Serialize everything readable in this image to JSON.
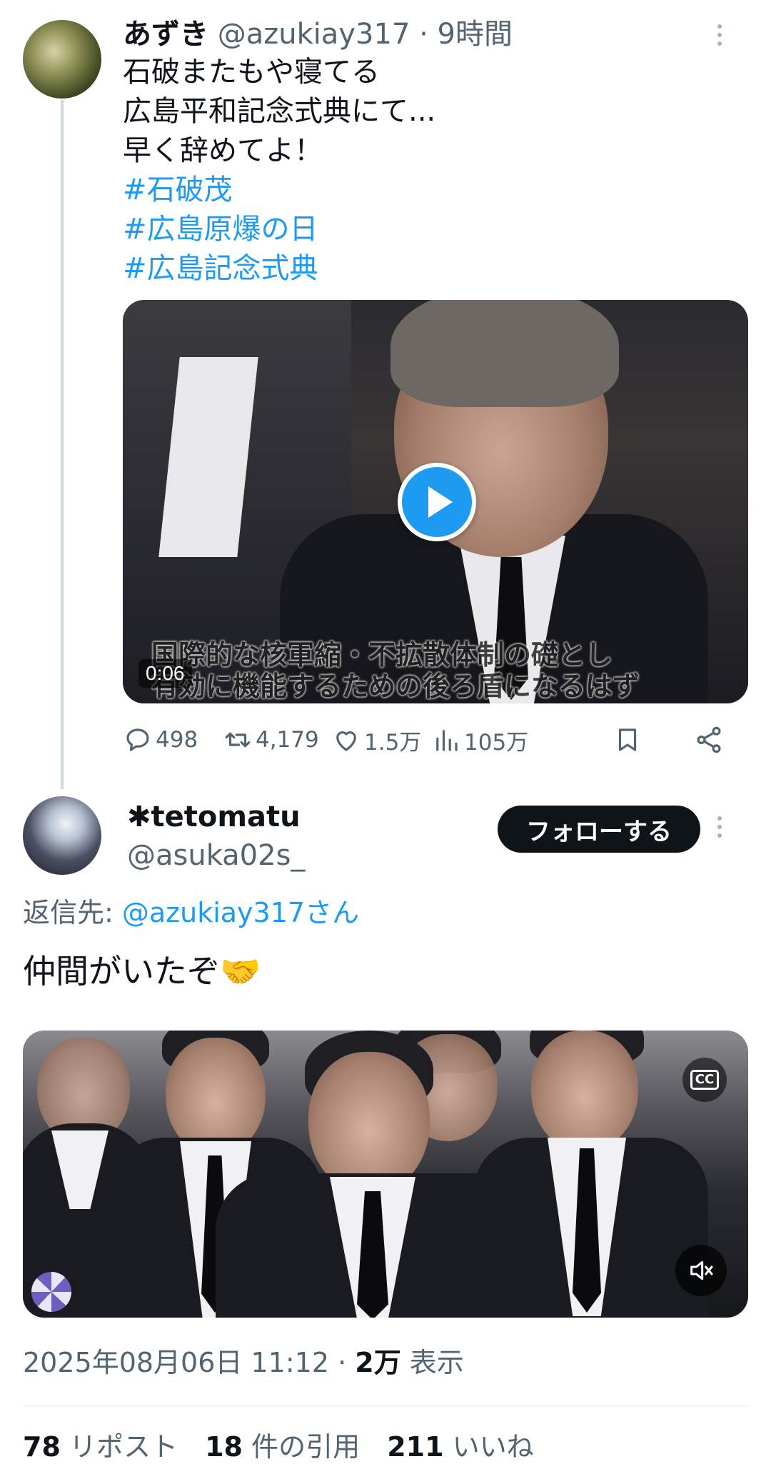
{
  "tweet1": {
    "display_name": "あずき",
    "handle": "@azukiay317",
    "separator": "·",
    "time_ago": "9時間",
    "lines": [
      "石破またもや寝てる",
      "広島平和記念式典にて...",
      "早く辞めてよ！"
    ],
    "hashtags": [
      "#石破茂",
      "#広島原爆の日",
      "#広島記念式典"
    ],
    "video": {
      "duration": "0:06",
      "subtitle_lines": [
        "国際的な核軍縮・不拡散体制の礎とし",
        "有効に機能するための後ろ盾になるはず"
      ]
    },
    "actions": {
      "replies": "498",
      "reposts": "4,179",
      "likes": "1.5万",
      "views": "105万"
    }
  },
  "tweet2": {
    "display_name": "✱tetomatu",
    "handle": "@asuka02s_",
    "follow_label": "フォローする",
    "reply_prefix": "返信先: ",
    "reply_handle": "@azukiay317さん",
    "text": "仲間がいたぞ🤝",
    "video": {
      "cc_label": "CC"
    },
    "timestamp": "2025年08月06日 11:12",
    "separator": " · ",
    "view_count": "2万",
    "view_label": " 表示",
    "stats": {
      "reposts_count": "78",
      "reposts_label": "リポスト",
      "quotes_count": "18",
      "quotes_label": "件の引用",
      "likes_count": "211",
      "likes_label": "いいね"
    }
  },
  "colors": {
    "accent": "#1d9bf0",
    "text": "#0f1419",
    "secondary": "#536471",
    "thread_line": "#cfd9de"
  },
  "icons": {
    "reply": "reply-bubble-icon",
    "repost": "repost-arrows-icon",
    "like": "heart-icon",
    "views": "bar-chart-icon",
    "bookmark": "bookmark-icon",
    "share": "share-icon",
    "more": "more-dots-icon",
    "play": "play-icon",
    "cc": "closed-captions-icon",
    "mute": "muted-speaker-icon"
  }
}
